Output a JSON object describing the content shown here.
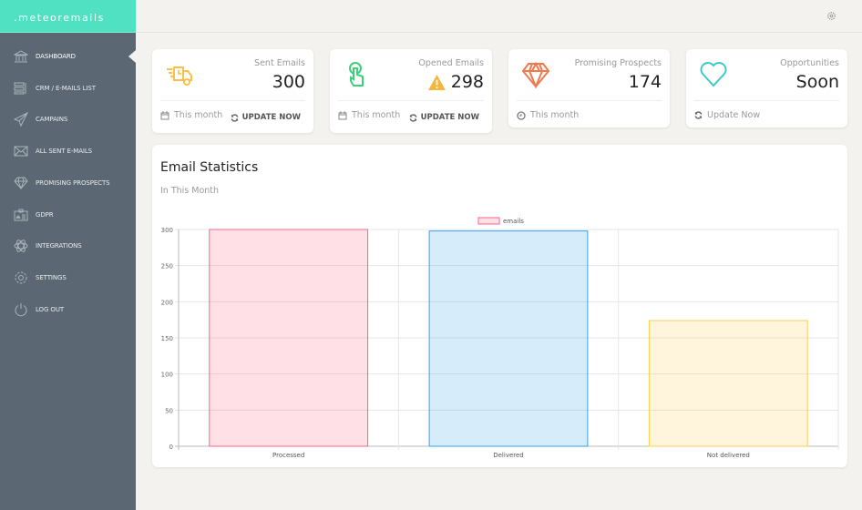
{
  "app": {
    "logo": ".meteoremails"
  },
  "sidebar": {
    "items": [
      {
        "label": "DASHBOARD",
        "icon": "bank-icon",
        "active": true
      },
      {
        "label": "CRM / E-MAILS LIST",
        "icon": "list-icon"
      },
      {
        "label": "CAMPAINS",
        "icon": "paper-plane-icon"
      },
      {
        "label": "ALL SENT E-MAILS",
        "icon": "envelope-icon"
      },
      {
        "label": "PROMISING PROSPECTS",
        "icon": "diamond-icon"
      },
      {
        "label": "GDPR",
        "icon": "id-card-icon"
      },
      {
        "label": "INTEGRATIONS",
        "icon": "atom-icon"
      },
      {
        "label": "SETTINGS",
        "icon": "gear-icon"
      },
      {
        "label": "LOG OUT",
        "icon": "power-icon"
      }
    ]
  },
  "cards": [
    {
      "label": "Sent Emails",
      "value": "300",
      "footer": "This month",
      "action": "UPDATE NOW",
      "icon": "delivery-truck-icon",
      "color": "#fbbf4a"
    },
    {
      "label": "Opened Emails",
      "value": "298",
      "footer": "This month",
      "action": "UPDATE NOW",
      "icon": "pointer-hand-icon",
      "color": "#3ecf7a",
      "warning": true
    },
    {
      "label": "Promising Prospects",
      "value": "174",
      "footer": "This month",
      "icon": "diamond-icon",
      "color": "#f07a4f"
    },
    {
      "label": "Opportunities",
      "value": "Soon",
      "footer": "Update Now",
      "icon": "heart-icon",
      "color": "#3ec9c9"
    }
  ],
  "stats": {
    "title": "Email Statistics",
    "subtitle": "In This Month"
  },
  "chart_data": {
    "type": "bar",
    "categories": [
      "Processed",
      "Delivered",
      "Not delivered"
    ],
    "series": [
      {
        "name": "emails",
        "values": [
          300,
          298,
          174
        ]
      }
    ],
    "colors": [
      "#ff6384",
      "#36a2eb",
      "#ffce56"
    ],
    "ylim": [
      0,
      300
    ],
    "yticks": [
      0,
      50,
      100,
      150,
      200,
      250,
      300
    ],
    "grid": true,
    "legend": "top"
  }
}
